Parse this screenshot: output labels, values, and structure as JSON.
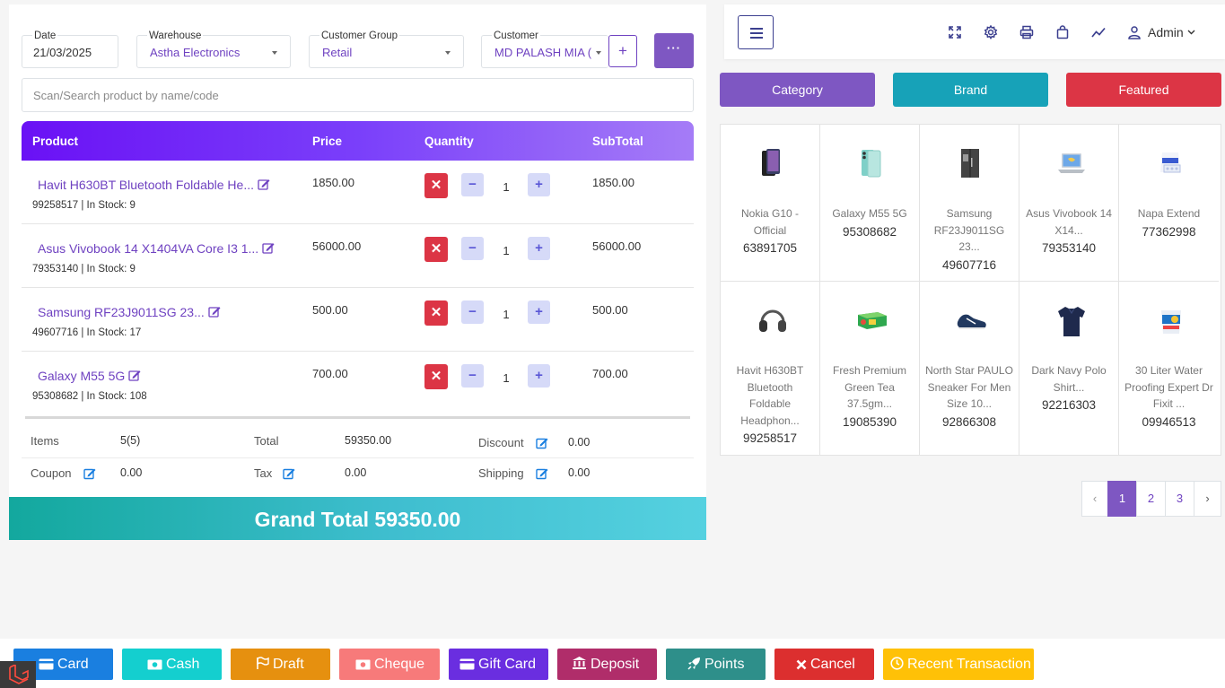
{
  "form": {
    "date": {
      "label": "Date",
      "value": "21/03/2025"
    },
    "warehouse": {
      "label": "Warehouse",
      "value": "Astha Electronics"
    },
    "customer_group": {
      "label": "Customer Group",
      "value": "Retail"
    },
    "customer": {
      "label": "Customer",
      "value": "MD PALASH MIA ("
    },
    "add_label": "+",
    "more_label": "···"
  },
  "search": {
    "placeholder": "Scan/Search product by name/code"
  },
  "table": {
    "headers": [
      "Product",
      "Price",
      "Quantity",
      "SubTotal"
    ],
    "rows": [
      {
        "name": "Havit H630BT Bluetooth Foldable He...",
        "meta": "99258517 | In Stock: 9",
        "price": "1850.00",
        "qty": "1",
        "subtotal": "1850.00"
      },
      {
        "name": "Asus Vivobook 14 X1404VA Core I3 1...",
        "meta": "79353140 | In Stock: 9",
        "price": "56000.00",
        "qty": "1",
        "subtotal": "56000.00"
      },
      {
        "name": "Samsung RF23J9011SG 23...",
        "meta": "49607716 | In Stock: 17",
        "price": "500.00",
        "qty": "1",
        "subtotal": "500.00"
      },
      {
        "name": "Galaxy M55 5G",
        "meta": "95308682 | In Stock: 108",
        "price": "700.00",
        "qty": "1",
        "subtotal": "700.00"
      }
    ],
    "delete_symbol": "✕",
    "minus_symbol": "−",
    "plus_symbol": "+"
  },
  "summary": {
    "items_label": "Items",
    "items_value": "5(5)",
    "total_label": "Total",
    "total_value": "59350.00",
    "discount_label": "Discount",
    "discount_value": "0.00",
    "coupon_label": "Coupon",
    "coupon_value": "0.00",
    "tax_label": "Tax",
    "tax_value": "0.00",
    "shipping_label": "Shipping",
    "shipping_value": "0.00"
  },
  "grand_total": "Grand Total 59350.00",
  "header": {
    "user": "Admin"
  },
  "tabs": {
    "category": "Category",
    "brand": "Brand",
    "featured": "Featured"
  },
  "products": [
    {
      "name": "Nokia G10 - Official",
      "code": "63891705",
      "icon": "phone-icon"
    },
    {
      "name": "Galaxy M55 5G",
      "code": "95308682",
      "icon": "phone-icon"
    },
    {
      "name": "Samsung RF23J9011SG 23...",
      "code": "49607716",
      "icon": "fridge-icon"
    },
    {
      "name": "Asus Vivobook 14 X14...",
      "code": "79353140",
      "icon": "laptop-icon"
    },
    {
      "name": "Napa Extend",
      "code": "77362998",
      "icon": "medicine-icon"
    },
    {
      "name": "Havit H630BT Bluetooth Foldable Headphon...",
      "code": "99258517",
      "icon": "headphone-icon"
    },
    {
      "name": "Fresh Premium Green Tea 37.5gm...",
      "code": "19085390",
      "icon": "tea-box-icon"
    },
    {
      "name": "North Star PAULO Sneaker For Men Size 10...",
      "code": "92866308",
      "icon": "sneaker-icon"
    },
    {
      "name": "Dark Navy Polo Shirt...",
      "code": "92216303",
      "icon": "shirt-icon"
    },
    {
      "name": "30 Liter Water Proofing Expert Dr Fixit ...",
      "code": "09946513",
      "icon": "bucket-icon"
    }
  ],
  "pagination": {
    "prev": "‹",
    "pages": [
      "1",
      "2",
      "3"
    ],
    "next": "›",
    "active": "1"
  },
  "actions": {
    "card": "Card",
    "cash": "Cash",
    "draft": "Draft",
    "cheque": "Cheque",
    "gift_card": "Gift Card",
    "deposit": "Deposit",
    "points": "Points",
    "cancel": "Cancel",
    "recent": "Recent Transaction"
  },
  "colors": {
    "purple": "#7e57c2",
    "brand_teal": "#17a2b8",
    "featured_red": "#dc3545",
    "card_blue": "#1a7fe0",
    "cash_cyan": "#14cfcf",
    "draft_orange": "#e6900f",
    "cheque_pink": "#f77a7a",
    "gift_violet": "#6a2ee0",
    "deposit_magenta": "#b02d6a",
    "points_teal": "#2e8f8a",
    "cancel_red": "#dc2f2f",
    "recent_yellow": "#ffc107"
  }
}
